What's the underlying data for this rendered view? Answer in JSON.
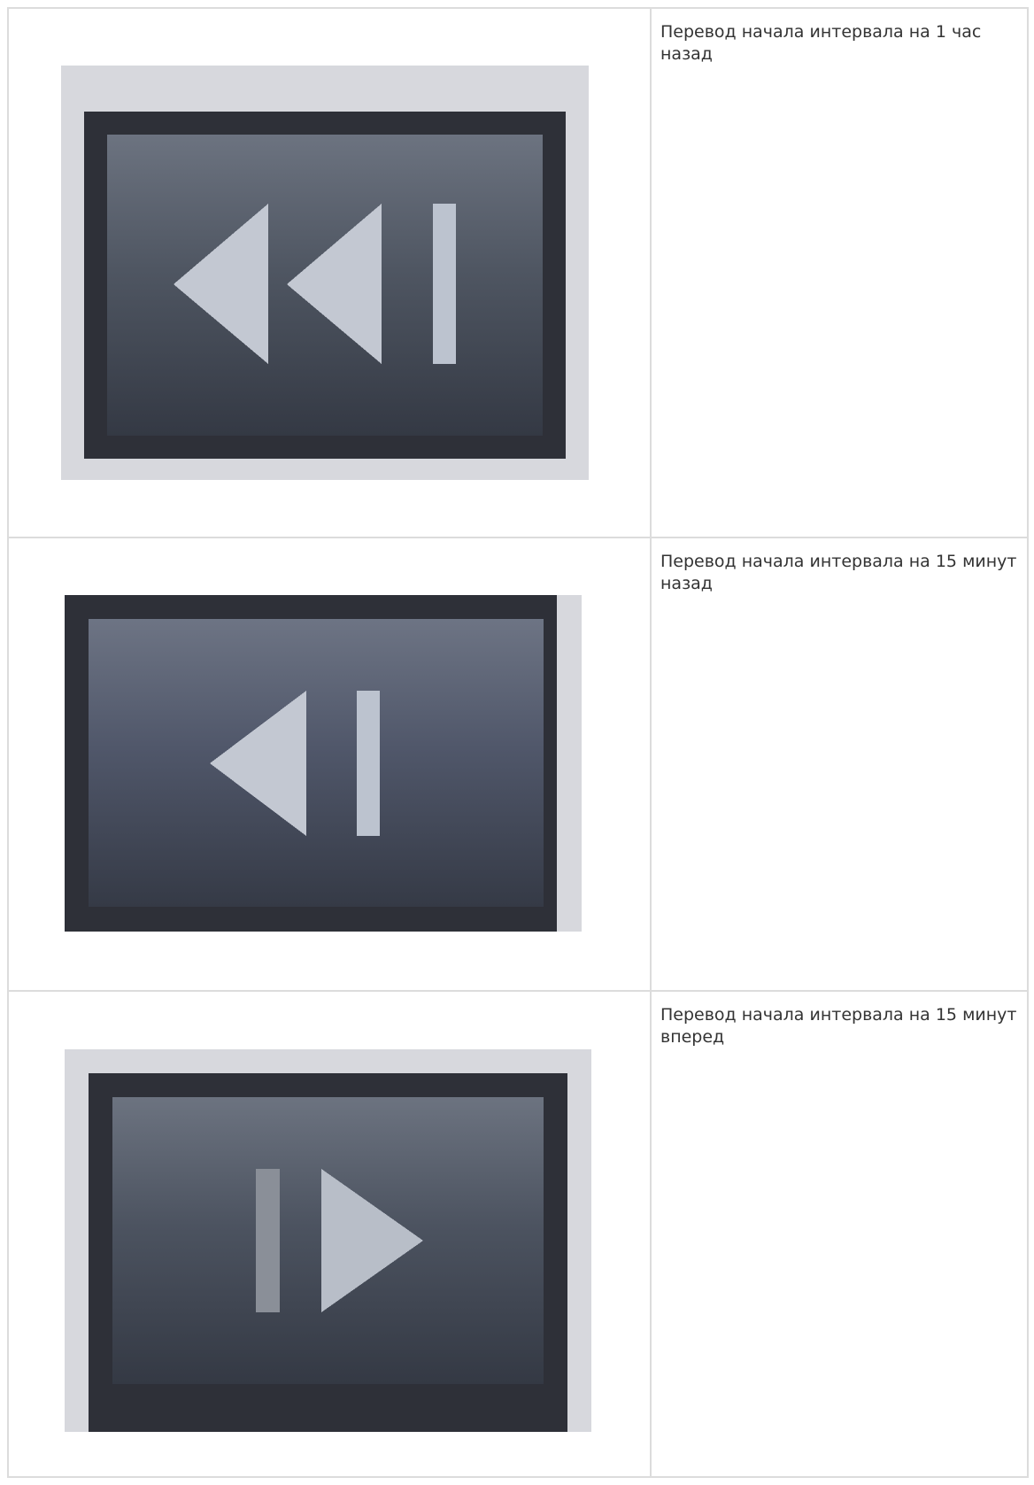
{
  "rows": [
    {
      "icon": "rewind-1-hour-back-icon",
      "description": "Перевод начала интервала на 1 час назад"
    },
    {
      "icon": "step-15-minutes-back-icon",
      "description": "Перевод начала интервала на 15 минут назад"
    },
    {
      "icon": "step-15-minutes-forward-icon",
      "description": "Перевод начала интервала на 15 минут вперед"
    }
  ],
  "colors": {
    "frame_light": "#d7d8dd",
    "frame_dark": "#2e3038",
    "panel_top": "#6c7380",
    "panel_bottom": "#363b46",
    "glyph": "#c9ced8",
    "glyph_dim": "#8a8f98",
    "table_border": "#dcdcdc",
    "text": "#333333"
  }
}
